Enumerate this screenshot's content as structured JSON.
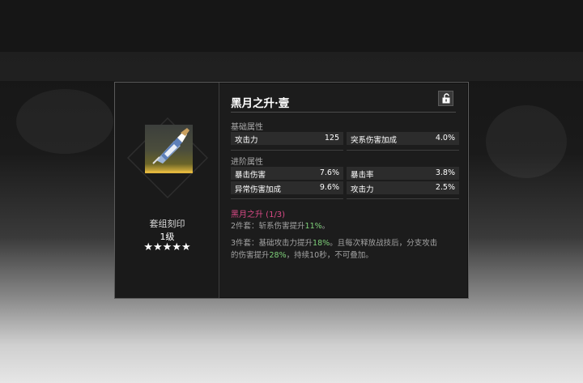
{
  "item": {
    "name": "黑月之升·壹",
    "set_label": "套组刻印",
    "level": "1级",
    "stars": "★★★★★",
    "icon": "dagger-gem-icon"
  },
  "lock": {
    "icon": "unlock-icon"
  },
  "base": {
    "label": "基础属性",
    "stats": [
      {
        "name": "攻击力",
        "value": "125"
      },
      {
        "name": "突系伤害加成",
        "value": "4.0%"
      }
    ]
  },
  "advanced": {
    "label": "进阶属性",
    "stats": [
      {
        "name": "暴击伤害",
        "value": "7.6%"
      },
      {
        "name": "暴击率",
        "value": "3.8%"
      },
      {
        "name": "异常伤害加成",
        "value": "9.6%"
      },
      {
        "name": "攻击力",
        "value": "2.5%"
      }
    ]
  },
  "set": {
    "name": "黑月之升 (1/3)",
    "two_piece": {
      "prefix": "2件套：斩系伤害提升",
      "hl": "11%",
      "suffix": "。"
    },
    "three_piece": {
      "line1_prefix": "3件套：基础攻击力提升",
      "line1_hl": "18%",
      "line1_suffix": "。且每次释放战技后，分支攻击",
      "line2_prefix": "的伤害提升",
      "line2_hl": "28%",
      "line2_suffix": "，持续10秒，不可叠加。"
    }
  },
  "colors": {
    "set_name": "#d94a86",
    "highlight": "#7fd17a",
    "rarity_gold": "#e1b63e"
  }
}
